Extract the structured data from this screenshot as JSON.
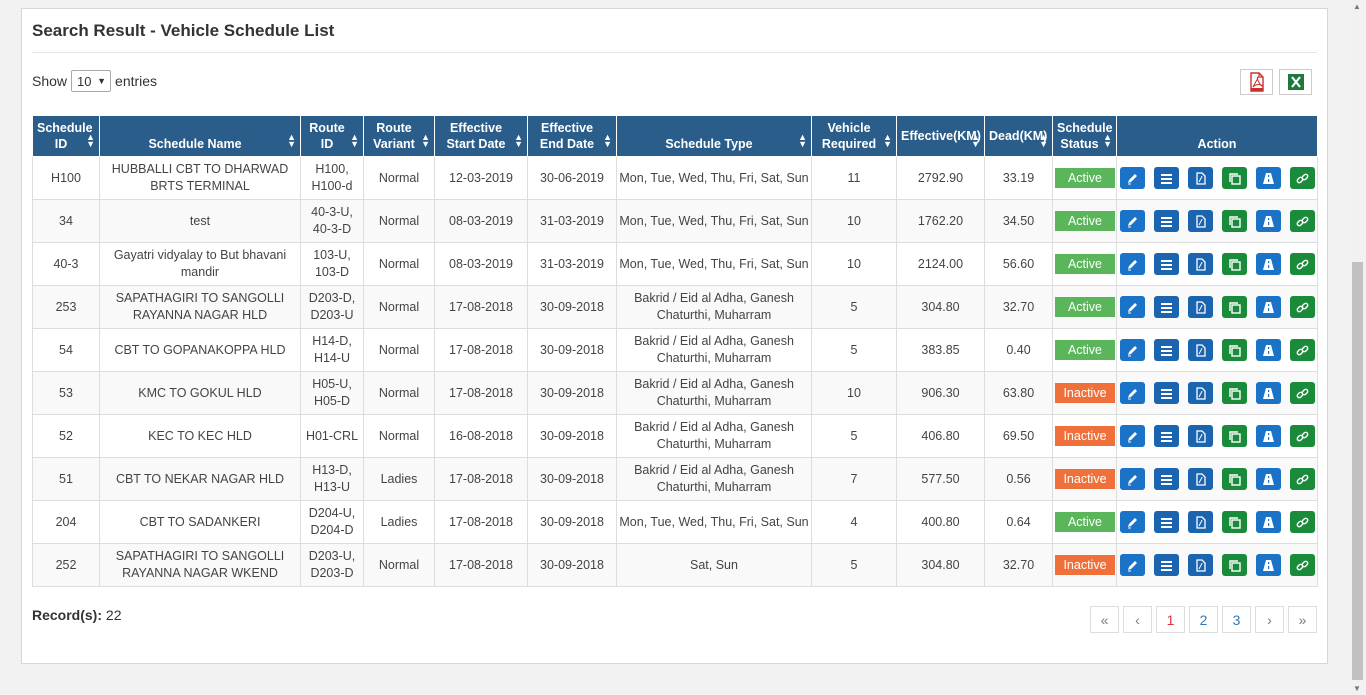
{
  "panel": {
    "title": "Search Result - Vehicle Schedule List",
    "show_label": "Show",
    "entries_label": "entries",
    "page_length": "10"
  },
  "export": {
    "pdf_icon": "pdf-file-icon",
    "excel_icon": "excel-file-icon"
  },
  "columns": [
    "Schedule ID",
    "Schedule Name",
    "Route ID",
    "Route Variant",
    "Effective Start Date",
    "Effective End Date",
    "Schedule Type",
    "Vehicle Required",
    "Effective(KM)",
    "Dead(KM)",
    "Schedule Status",
    "Action"
  ],
  "rows": [
    {
      "id": "H100",
      "name": "HUBBALLI CBT TO DHARWAD BRTS TERMINAL",
      "route": "H100, H100-d",
      "variant": "Normal",
      "start": "12-03-2019",
      "end": "30-06-2019",
      "type": "Mon, Tue, Wed, Thu, Fri, Sat, Sun",
      "vehicles": "11",
      "eff_km": "2792.90",
      "dead_km": "33.19",
      "status": "Active"
    },
    {
      "id": "34",
      "name": "test",
      "route": "40-3-U, 40-3-D",
      "variant": "Normal",
      "start": "08-03-2019",
      "end": "31-03-2019",
      "type": "Mon, Tue, Wed, Thu, Fri, Sat, Sun",
      "vehicles": "10",
      "eff_km": "1762.20",
      "dead_km": "34.50",
      "status": "Active"
    },
    {
      "id": "40-3",
      "name": "Gayatri vidyalay to But bhavani mandir",
      "route": "103-U, 103-D",
      "variant": "Normal",
      "start": "08-03-2019",
      "end": "31-03-2019",
      "type": "Mon, Tue, Wed, Thu, Fri, Sat, Sun",
      "vehicles": "10",
      "eff_km": "2124.00",
      "dead_km": "56.60",
      "status": "Active"
    },
    {
      "id": "253",
      "name": "SAPATHAGIRI TO SANGOLLI RAYANNA NAGAR HLD",
      "route": "D203-D, D203-U",
      "variant": "Normal",
      "start": "17-08-2018",
      "end": "30-09-2018",
      "type": "Bakrid / Eid al Adha, Ganesh Chaturthi, Muharram",
      "vehicles": "5",
      "eff_km": "304.80",
      "dead_km": "32.70",
      "status": "Active"
    },
    {
      "id": "54",
      "name": "CBT TO GOPANAKOPPA HLD",
      "route": "H14-D, H14-U",
      "variant": "Normal",
      "start": "17-08-2018",
      "end": "30-09-2018",
      "type": "Bakrid / Eid al Adha, Ganesh Chaturthi, Muharram",
      "vehicles": "5",
      "eff_km": "383.85",
      "dead_km": "0.40",
      "status": "Active"
    },
    {
      "id": "53",
      "name": "KMC TO GOKUL HLD",
      "route": "H05-U, H05-D",
      "variant": "Normal",
      "start": "17-08-2018",
      "end": "30-09-2018",
      "type": "Bakrid / Eid al Adha, Ganesh Chaturthi, Muharram",
      "vehicles": "10",
      "eff_km": "906.30",
      "dead_km": "63.80",
      "status": "Inactive"
    },
    {
      "id": "52",
      "name": "KEC TO KEC HLD",
      "route": "H01-CRL",
      "variant": "Normal",
      "start": "16-08-2018",
      "end": "30-09-2018",
      "type": "Bakrid / Eid al Adha, Ganesh Chaturthi, Muharram",
      "vehicles": "5",
      "eff_km": "406.80",
      "dead_km": "69.50",
      "status": "Inactive"
    },
    {
      "id": "51",
      "name": "CBT TO NEKAR NAGAR HLD",
      "route": "H13-D, H13-U",
      "variant": "Ladies",
      "start": "17-08-2018",
      "end": "30-09-2018",
      "type": "Bakrid / Eid al Adha, Ganesh Chaturthi, Muharram",
      "vehicles": "7",
      "eff_km": "577.50",
      "dead_km": "0.56",
      "status": "Inactive"
    },
    {
      "id": "204",
      "name": "CBT TO SADANKERI",
      "route": "D204-U, D204-D",
      "variant": "Ladies",
      "start": "17-08-2018",
      "end": "30-09-2018",
      "type": "Mon, Tue, Wed, Thu, Fri, Sat, Sun",
      "vehicles": "4",
      "eff_km": "400.80",
      "dead_km": "0.64",
      "status": "Active"
    },
    {
      "id": "252",
      "name": "SAPATHAGIRI TO SANGOLLI RAYANNA NAGAR WKEND",
      "route": "D203-U, D203-D",
      "variant": "Normal",
      "start": "17-08-2018",
      "end": "30-09-2018",
      "type": "Sat, Sun",
      "vehicles": "5",
      "eff_km": "304.80",
      "dead_km": "32.70",
      "status": "Inactive"
    }
  ],
  "action_icons": [
    "edit-icon",
    "list-icon",
    "pdf-icon",
    "copy-icon",
    "road-icon",
    "link-icon"
  ],
  "colors": {
    "header": "#2b5d8a",
    "active": "#5bb55b",
    "inactive": "#f0703c",
    "btn_blue": "#1a73c7",
    "btn_green": "#1a8a3b"
  },
  "footer": {
    "records_label": "Record(s):",
    "records_count": "22",
    "pager": [
      "«",
      "‹",
      "1",
      "2",
      "3",
      "›",
      "»"
    ],
    "current_page": "1"
  }
}
